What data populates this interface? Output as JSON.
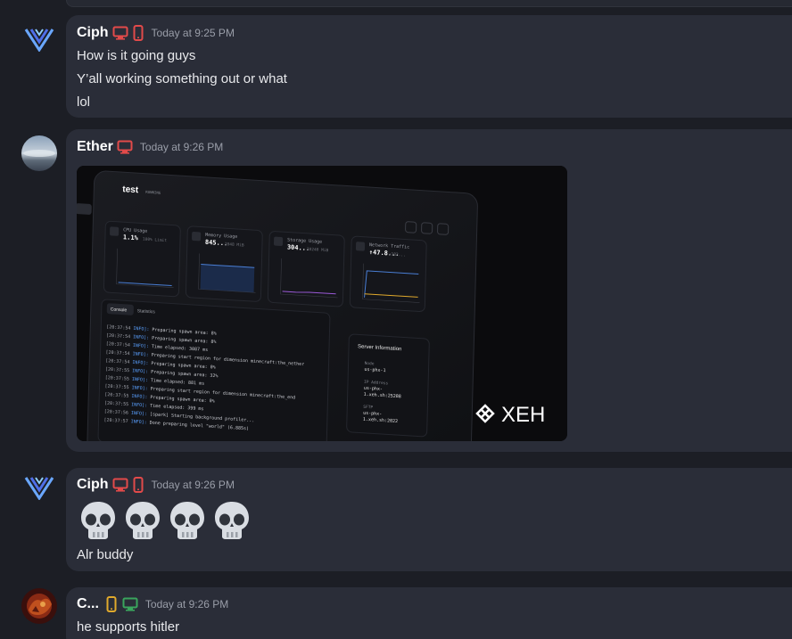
{
  "colors": {
    "bg": "#1c1e25",
    "card": "#2a2d38",
    "desktop_icon_red": "#e24a4a",
    "mobile_icon_yellow": "#e0a92c",
    "desktop_icon_green": "#3aa55d"
  },
  "messages": [
    {
      "author": "Ciph",
      "time": "Today at 9:25 PM",
      "badges": [
        "desktop-icon",
        "mobile-icon"
      ],
      "lines": [
        "How is it going guys",
        "Y’all working something out or what",
        "lol"
      ]
    },
    {
      "author": "Ether",
      "time": "Today at 9:26 PM",
      "badges": [
        "desktop-icon"
      ],
      "attachment": {
        "server_name": "test",
        "status": "RUNNING",
        "stats": [
          {
            "label": "CPU Usage",
            "value": "1.1%",
            "sub": "100% Limit"
          },
          {
            "label": "Memory Usage",
            "value": "845...",
            "sub": "2048 MiB"
          },
          {
            "label": "Storage Usage",
            "value": "304...",
            "sub": "10240 MiB"
          },
          {
            "label": "Network Traffic",
            "value": "↑47.8...",
            "sub": "↓183..."
          }
        ],
        "tabs": [
          "Console",
          "Statistics"
        ],
        "console": [
          {
            "time": "[20:37:54",
            "msg": "Preparing spawn area: 8%"
          },
          {
            "time": "[20:37:54",
            "msg": "Preparing spawn area: 8%"
          },
          {
            "time": "[20:37:54",
            "msg": "Time elapsed: 3087 ms"
          },
          {
            "time": "[20:37:54",
            "msg": "Preparing start region for dimension minecraft:the_nether"
          },
          {
            "time": "[20:37:54",
            "msg": "Preparing spawn area: 0%"
          },
          {
            "time": "[20:37:55",
            "msg": "Preparing spawn area: 32%"
          },
          {
            "time": "[20:37:55",
            "msg": "Time elapsed: 881 ms"
          },
          {
            "time": "[20:37:55",
            "msg": "Preparing start region for dimension minecraft:the_end"
          },
          {
            "time": "[20:37:55",
            "msg": "Preparing spawn area: 0%"
          },
          {
            "time": "[20:37:55",
            "msg": "Time elapsed: 399 ms"
          },
          {
            "time": "[20:37:56",
            "msg": "[spark] Starting background profiler..."
          },
          {
            "time": "[20:37:57",
            "msg": "Done preparing level \"world\" (6.885s)"
          }
        ],
        "info_label": "INFO]:",
        "server_info": {
          "title": "Server Information",
          "node_label": "Node",
          "node": "us-phx-1",
          "ip_label": "IP Address",
          "ip_line1": "us-phx-",
          "ip_line2": "1.xeh.sh:25288",
          "sftp_label": "SFTP",
          "sftp_line1": "us-phx-",
          "sftp_line2": "1.xeh.sh:2022"
        },
        "brand": "XEH"
      }
    },
    {
      "author": "Ciph",
      "time": "Today at 9:26 PM",
      "badges": [
        "desktop-icon",
        "mobile-icon"
      ],
      "emoji": [
        "skull-emoji",
        "skull-emoji",
        "skull-emoji",
        "skull-emoji"
      ],
      "lines": [
        "Alr buddy"
      ]
    },
    {
      "author": "C...",
      "time": "Today at 9:26 PM",
      "badges": [
        "mobile-icon",
        "desktop-icon"
      ],
      "lines": [
        "he supports hitler"
      ]
    }
  ]
}
